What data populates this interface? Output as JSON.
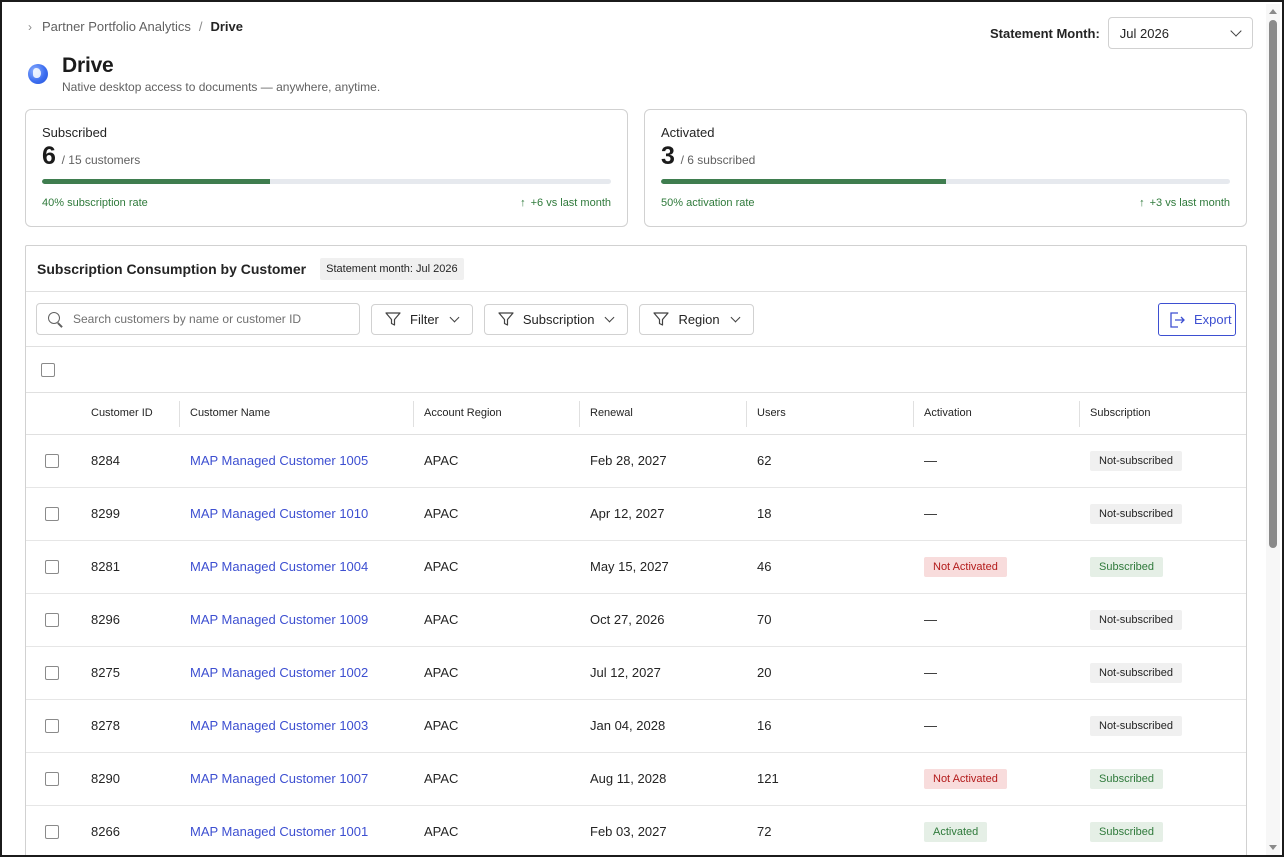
{
  "breadcrumb": {
    "parent": "Partner Portfolio Analytics",
    "separator": "/",
    "current": "Drive"
  },
  "statement_month": {
    "label": "Statement Month:",
    "value": "Jul 2026"
  },
  "header": {
    "title": "Drive",
    "subtitle": "Native desktop access to documents — anywhere, anytime."
  },
  "cards": [
    {
      "label": "Subscribed",
      "value": "6",
      "of": "/ 15 customers",
      "progress": 0.4,
      "rate": "40% subscription rate",
      "delta": "+6 vs last month"
    },
    {
      "label": "Activated",
      "value": "3",
      "of": "/ 6 subscribed",
      "progress": 0.5,
      "rate": "50% activation rate",
      "delta": "+3 vs last month"
    }
  ],
  "table_panel": {
    "title": "Subscription Consumption by Customer",
    "month_tag": "Statement month: Jul 2026",
    "search_placeholder": "Search customers by name or customer ID",
    "filters": [
      "Filter",
      "Subscription",
      "Region"
    ],
    "export_label": "Export",
    "columns": [
      "Customer ID",
      "Customer Name",
      "Account Region",
      "Renewal",
      "Users",
      "Activation",
      "Subscription"
    ],
    "rows": [
      {
        "id": "8284",
        "name": "MAP Managed Customer 1005",
        "region": "APAC",
        "renewal": "Feb 28, 2027",
        "users": "62",
        "activation": "—",
        "subscription": "Not-subscribed"
      },
      {
        "id": "8299",
        "name": "MAP Managed Customer 1010",
        "region": "APAC",
        "renewal": "Apr 12, 2027",
        "users": "18",
        "activation": "—",
        "subscription": "Not-subscribed"
      },
      {
        "id": "8281",
        "name": "MAP Managed Customer 1004",
        "region": "APAC",
        "renewal": "May 15, 2027",
        "users": "46",
        "activation": "Not Activated",
        "subscription": "Subscribed"
      },
      {
        "id": "8296",
        "name": "MAP Managed Customer 1009",
        "region": "APAC",
        "renewal": "Oct 27, 2026",
        "users": "70",
        "activation": "—",
        "subscription": "Not-subscribed"
      },
      {
        "id": "8275",
        "name": "MAP Managed Customer 1002",
        "region": "APAC",
        "renewal": "Jul 12, 2027",
        "users": "20",
        "activation": "—",
        "subscription": "Not-subscribed"
      },
      {
        "id": "8278",
        "name": "MAP Managed Customer 1003",
        "region": "APAC",
        "renewal": "Jan 04, 2028",
        "users": "16",
        "activation": "—",
        "subscription": "Not-subscribed"
      },
      {
        "id": "8290",
        "name": "MAP Managed Customer 1007",
        "region": "APAC",
        "renewal": "Aug 11, 2028",
        "users": "121",
        "activation": "Not Activated",
        "subscription": "Subscribed"
      },
      {
        "id": "8266",
        "name": "MAP Managed Customer 1001",
        "region": "APAC",
        "renewal": "Feb 03, 2027",
        "users": "72",
        "activation": "Activated",
        "subscription": "Subscribed"
      }
    ]
  },
  "colors": {
    "accent": "#3d4fd1",
    "progress": "#3f7d4f",
    "positive": "#2f7a3b",
    "negative": "#b31b1b"
  },
  "icons": {
    "breadcrumb": "chevron-right-icon",
    "product": "globe-icon",
    "search": "search-icon",
    "filter": "funnel-icon",
    "export": "export-icon"
  }
}
